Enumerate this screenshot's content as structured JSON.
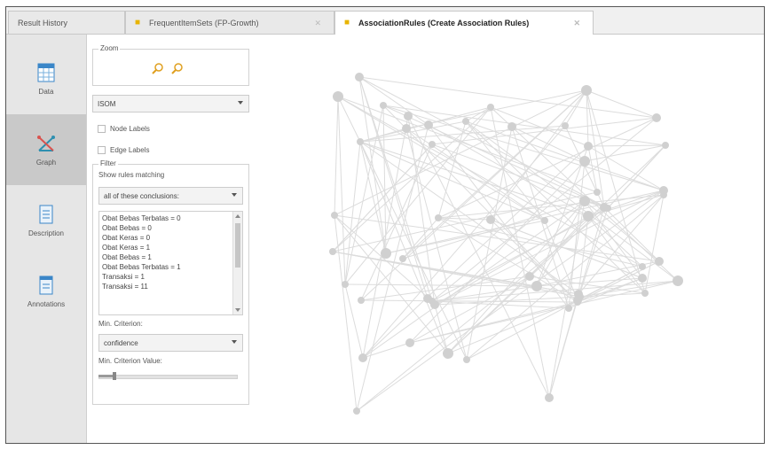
{
  "tabs": [
    {
      "label": "Result History",
      "active": false
    },
    {
      "label": "FrequentItemSets (FP-Growth)",
      "active": false
    },
    {
      "label": "AssociationRules (Create Association Rules)",
      "active": true
    }
  ],
  "sidebar": {
    "items": [
      {
        "label": "Data",
        "icon": "table-icon",
        "active": false
      },
      {
        "label": "Graph",
        "icon": "graph-icon",
        "active": true
      },
      {
        "label": "Description",
        "icon": "document-icon",
        "active": false
      },
      {
        "label": "Annotations",
        "icon": "annotations-icon",
        "active": false
      }
    ]
  },
  "zoom": {
    "label": "Zoom"
  },
  "layout_select": {
    "value": "ISOM"
  },
  "node_labels": {
    "label": "Node Labels",
    "checked": false
  },
  "edge_labels": {
    "label": "Edge Labels",
    "checked": false
  },
  "filter": {
    "label": "Filter",
    "show_rules_label": "Show rules matching",
    "match_select": "all of these conclusions:",
    "rules": [
      "Obat Bebas Terbatas = 0",
      "Obat Bebas = 0",
      "Obat Keras = 0",
      "Obat Keras = 1",
      "Obat Bebas = 1",
      "Obat Bebas Terbatas = 1",
      "Transaksi = 1",
      "Transaksi = 11"
    ],
    "min_criterion_label": "Min. Criterion:",
    "criterion_select": "confidence",
    "min_criterion_value_label": "Min. Criterion Value:",
    "min_criterion_value_fraction": 0.12
  },
  "colors": {
    "accent_tab_icon": "#e8b400",
    "sidebar_active": "#c9c9c9",
    "graph": "#d0d0d0"
  }
}
